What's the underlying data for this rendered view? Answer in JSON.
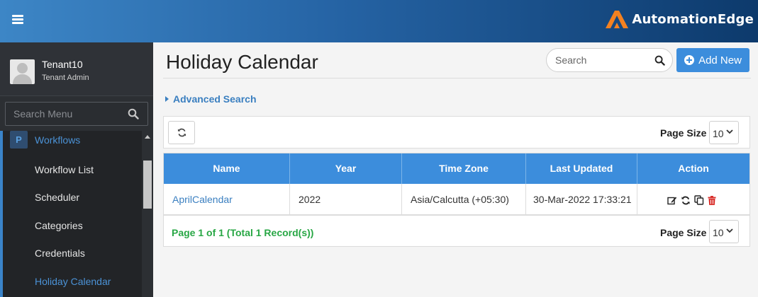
{
  "brand": {
    "name": "AutomationEdge",
    "accent": "#f48120"
  },
  "user": {
    "name": "Tenant10",
    "role": "Tenant Admin"
  },
  "sidebar": {
    "search_placeholder": "Search Menu",
    "group": "Workflows",
    "items": [
      {
        "label": "Workflow List"
      },
      {
        "label": "Scheduler"
      },
      {
        "label": "Categories"
      },
      {
        "label": "Credentials"
      },
      {
        "label": "Holiday Calendar",
        "active": true
      }
    ]
  },
  "header": {
    "title": "Holiday Calendar",
    "search_placeholder": "Search",
    "add_label": "Add New"
  },
  "advanced_search": "Advanced Search",
  "page_size": {
    "label": "Page Size",
    "value": "10"
  },
  "table": {
    "columns": [
      "Name",
      "Year",
      "Time Zone",
      "Last Updated",
      "Action"
    ],
    "rows": [
      {
        "name": "AprilCalendar",
        "year": "2022",
        "timezone": "Asia/Calcutta (+05:30)",
        "updated": "30-Mar-2022 17:33:21"
      }
    ]
  },
  "pagination": {
    "info": "Page 1 of 1 (Total 1 Record(s))"
  },
  "colors": {
    "primary": "#3c8ddc",
    "success": "#28a745",
    "danger": "#d9302c",
    "sidebar": "#222427"
  }
}
